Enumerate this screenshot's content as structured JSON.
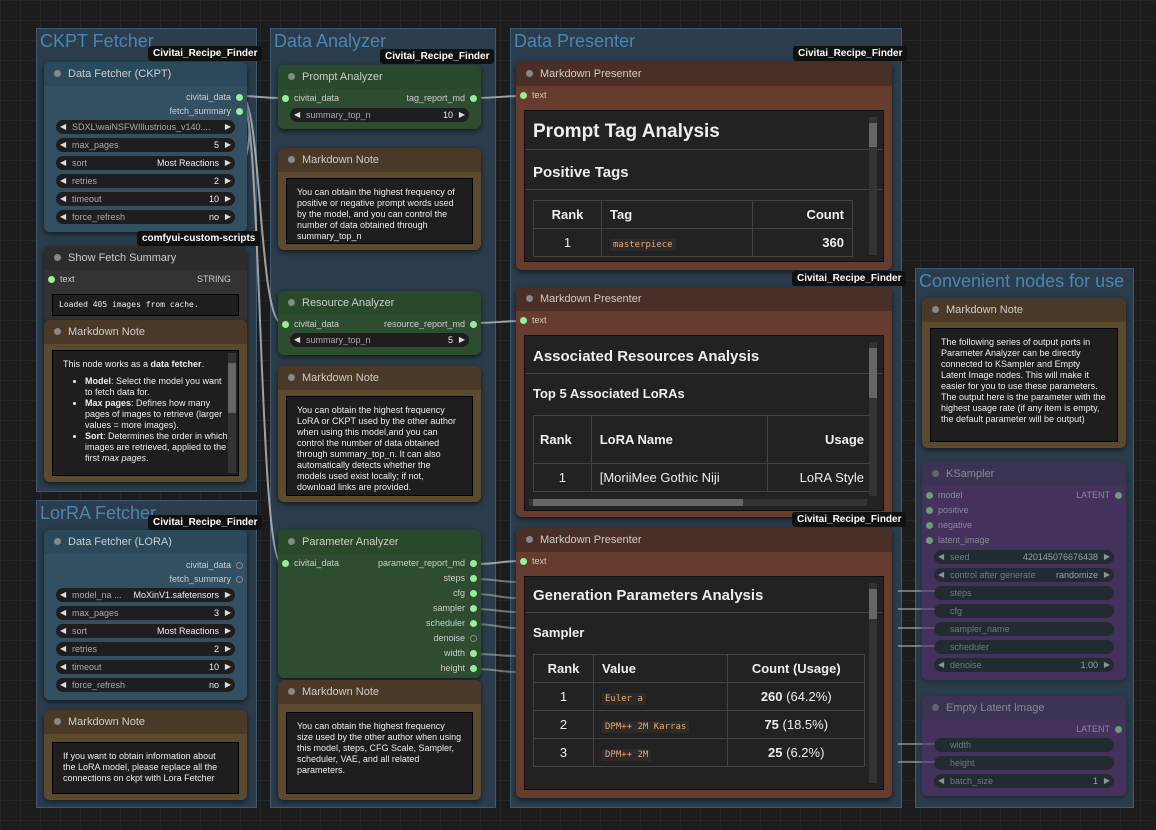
{
  "groups": {
    "ckpt": "CKPT Fetcher",
    "analyzer": "Data Analyzer",
    "presenter": "Data Presenter",
    "lora": "LorRA Fetcher",
    "convenient": "Convenient nodes for use"
  },
  "badges": {
    "recipe": "Civitai_Recipe_Finder",
    "scripts": "comfyui-custom-scripts"
  },
  "ckpt_node": {
    "title": "Data Fetcher (CKPT)",
    "out1": "civitai_data",
    "out2": "fetch_summary",
    "model": "SDXL\\waiNSFWIllustrious_v140....",
    "max_pages_l": "max_pages",
    "max_pages_v": "5",
    "sort_l": "sort",
    "sort_v": "Most Reactions",
    "retries_l": "retries",
    "retries_v": "2",
    "timeout_l": "timeout",
    "timeout_v": "10",
    "force_l": "force_refresh",
    "force_v": "no"
  },
  "summary_node": {
    "title": "Show Fetch Summary",
    "in": "text",
    "type": "STRING",
    "text": "Loaded 405 images from cache."
  },
  "md_ckpt": {
    "title": "Markdown Note",
    "intro": "This node works as a ",
    "intro_b": "data fetcher",
    "li1_b": "Model",
    "li1": ": Select the model you want to fetch data for.",
    "li2_b": "Max pages",
    "li2": ": Defines how many pages of images to retrieve (larger values = more images).",
    "li3_b": "Sort",
    "li3": ": Determines the order in which images are retrieved, applied to the first ",
    "li3_i": "max pages",
    "li3_end": "."
  },
  "lora_node": {
    "title": "Data Fetcher (LORA)",
    "out1": "civitai_data",
    "out2": "fetch_summary",
    "model_l": "model_na ...",
    "model_v": "MoXinV1.safetensors",
    "max_pages_l": "max_pages",
    "max_pages_v": "3",
    "sort_l": "sort",
    "sort_v": "Most Reactions",
    "retries_l": "retries",
    "retries_v": "2",
    "timeout_l": "timeout",
    "timeout_v": "10",
    "force_l": "force_refresh",
    "force_v": "no"
  },
  "md_lora": {
    "title": "Markdown Note",
    "text": "If you want to obtain information about the LoRA model, please replace all the connections on ckpt with Lora Fetcher"
  },
  "prompt_node": {
    "title": "Prompt Analyzer",
    "in": "civitai_data",
    "out": "tag_report_md",
    "w_l": "summary_top_n",
    "w_v": "10"
  },
  "md_prompt": {
    "title": "Markdown Note",
    "text": "You can obtain the highest frequency of positive or negative prompt words used by the model, and you can control the number of data obtained through summary_top_n"
  },
  "resource_node": {
    "title": "Resource Analyzer",
    "in": "civitai_data",
    "out": "resource_report_md",
    "w_l": "summary_top_n",
    "w_v": "5"
  },
  "md_resource": {
    "title": "Markdown Note",
    "text": "You can obtain the highest frequency LoRA or CKPT used by the other author when using this model,and you can control the number of data obtained through summary_top_n. It can also automatically detects whether the models used exist locally; if not, download links are provided."
  },
  "param_node": {
    "title": "Parameter Analyzer",
    "in": "civitai_data",
    "outs": [
      "parameter_report_md",
      "steps",
      "cfg",
      "sampler",
      "scheduler",
      "denoise",
      "width",
      "height"
    ]
  },
  "md_param": {
    "title": "Markdown Note",
    "text": "You can obtain the highest frequency size used by the other author when using this model, steps, CFG Scale, Sampler, scheduler, VAE, and all related parameters."
  },
  "pres1": {
    "title": "Markdown Presenter",
    "in": "text",
    "h1": "Prompt Tag Analysis",
    "h2": "Positive Tags",
    "cols": [
      "Rank",
      "Tag",
      "Count"
    ],
    "row": [
      "1",
      "masterpiece",
      "360"
    ]
  },
  "pres2": {
    "title": "Markdown Presenter",
    "in": "text",
    "h2": "Associated Resources Analysis",
    "h3": "Top 5 Associated LoRAs",
    "cols": [
      "Rank",
      "LoRA Name",
      "Usage"
    ],
    "row": [
      "1",
      "[MoriiMee Gothic Niji",
      "LoRA Style"
    ]
  },
  "pres3": {
    "title": "Markdown Presenter",
    "in": "text",
    "h2": "Generation Parameters Analysis",
    "h3": "Sampler",
    "cols": [
      "Rank",
      "Value",
      "Count (Usage)"
    ],
    "rows": [
      [
        "1",
        "Euler a",
        "260",
        "(64.2%)"
      ],
      [
        "2",
        "DPM++ 2M Karras",
        "75",
        "(18.5%)"
      ],
      [
        "3",
        "DPM++ 2M",
        "25",
        "(6.2%)"
      ]
    ]
  },
  "md_conv": {
    "title": "Markdown Note",
    "text": "The following series of output ports in Parameter Analyzer can be directly connected to KSampler and Empty Latent Image nodes. This will make it easier for you to use these parameters. The output here is the parameter with the highest usage rate (if any item is empty, the default parameter will be output)"
  },
  "ksampler": {
    "title": "KSampler",
    "ins": [
      "model",
      "positive",
      "negative",
      "latent_image"
    ],
    "out": "LATENT",
    "seed_l": "seed",
    "seed_v": "420145076676438",
    "cag_l": "control after generate",
    "cag_v": "randomize",
    "r1": "steps",
    "r2": "cfg",
    "r3": "sampler_name",
    "r4": "scheduler",
    "den_l": "denoise",
    "den_v": "1.00"
  },
  "empty_latent": {
    "title": "Empty Latent Image",
    "out": "LATENT",
    "r1": "width",
    "r2": "height",
    "bs_l": "batch_size",
    "bs_v": "1"
  }
}
